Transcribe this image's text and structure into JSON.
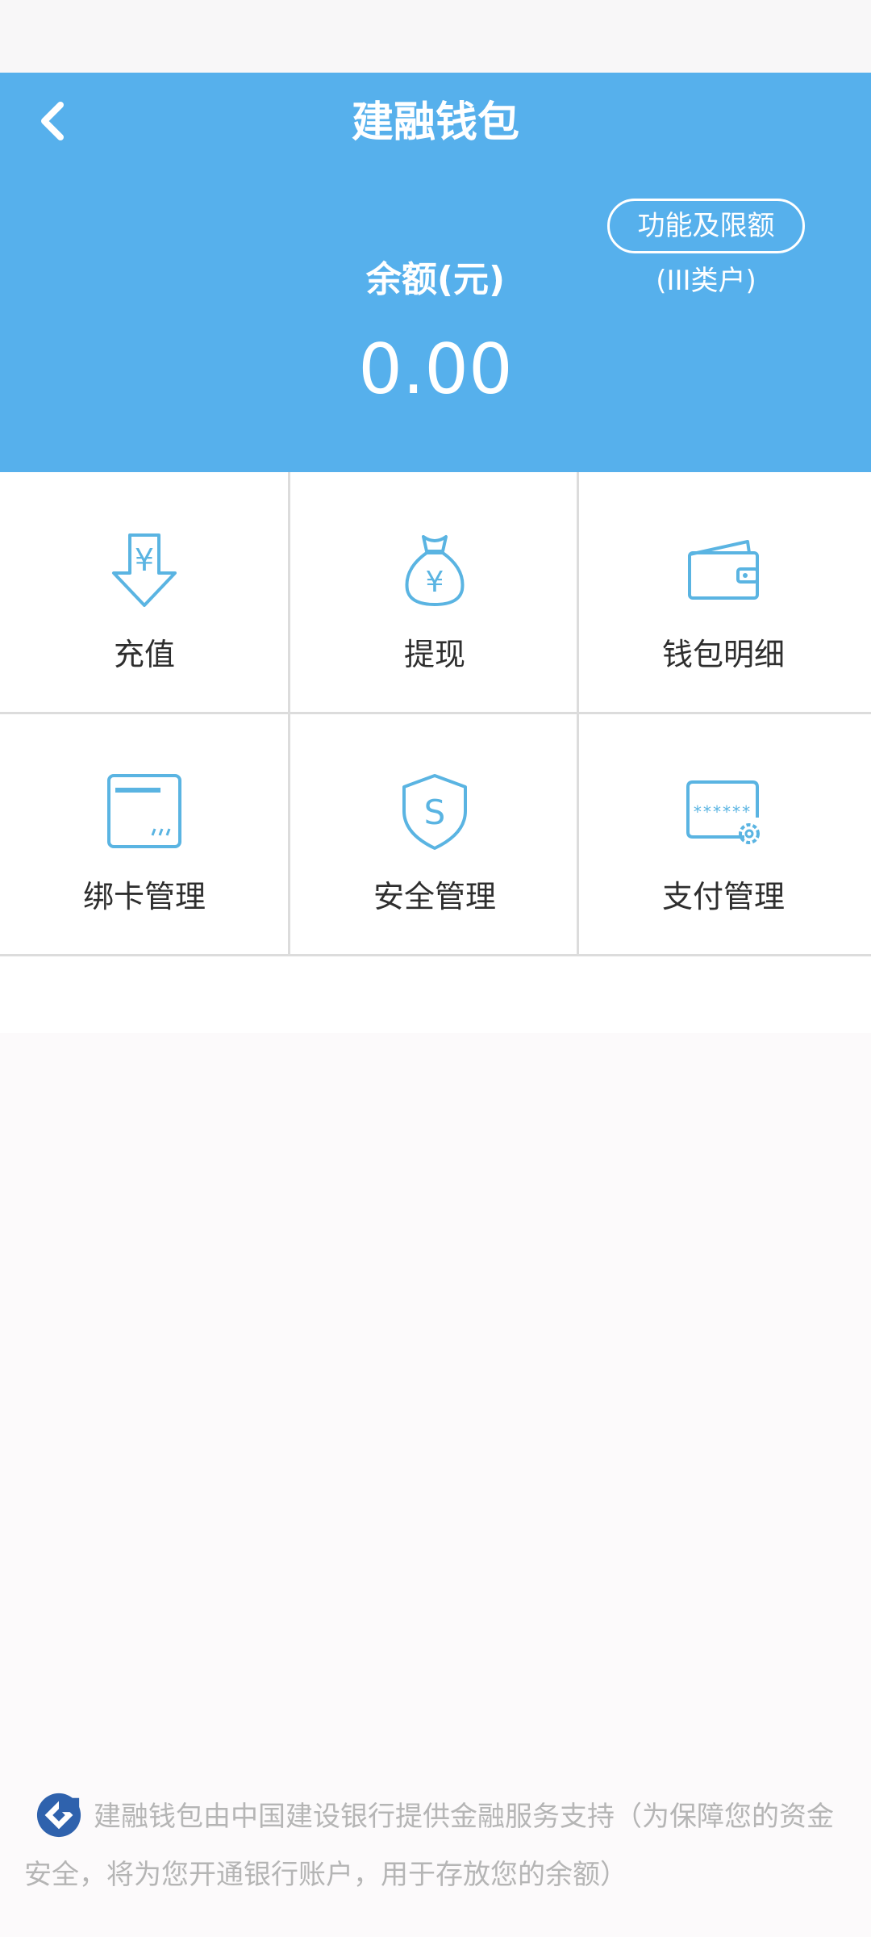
{
  "header": {
    "title": "建融钱包",
    "limits_button": "功能及限额",
    "account_class": "(III类户)",
    "balance_label": "余额(元)",
    "balance_value": "0.00"
  },
  "grid": {
    "items": [
      {
        "label": "充值",
        "icon": "deposit-arrow-yuan-icon"
      },
      {
        "label": "提现",
        "icon": "money-bag-yuan-icon"
      },
      {
        "label": "钱包明细",
        "icon": "wallet-icon"
      },
      {
        "label": "绑卡管理",
        "icon": "bank-card-icon"
      },
      {
        "label": "安全管理",
        "icon": "shield-s-icon"
      },
      {
        "label": "支付管理",
        "icon": "password-card-gear-icon"
      }
    ]
  },
  "footer": {
    "text": "建融钱包由中国建设银行提供金融服务支持（为保障您的资金安全，将为您开通银行账户，用于存放您的余额）"
  },
  "colors": {
    "header_bg": "#56b0ec",
    "icon_blue": "#5ab4e2",
    "logo_blue": "#2f62ad"
  }
}
